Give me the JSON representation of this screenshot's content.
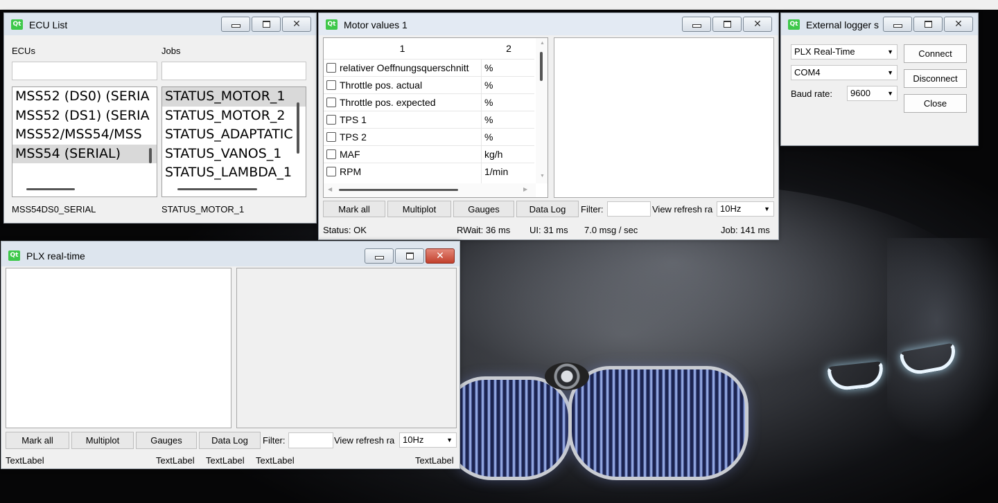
{
  "ecu_window": {
    "title": "ECU List",
    "ecus_label": "ECUs",
    "jobs_label": "Jobs",
    "ecus": [
      "MSS52 (DS0) (SERIA",
      "MSS52 (DS1) (SERIA",
      "MSS52/MSS54/MSS",
      "MSS54 (SERIAL)"
    ],
    "jobs": [
      "STATUS_MOTOR_1",
      "STATUS_MOTOR_2",
      "STATUS_ADAPTATIC",
      "STATUS_VANOS_1",
      "STATUS_LAMBDA_1"
    ],
    "selected_ecu": "MSS54DS0_SERIAL",
    "selected_job": "STATUS_MOTOR_1"
  },
  "motor_window": {
    "title": "Motor values 1",
    "columns": [
      "1",
      "2"
    ],
    "rows": [
      {
        "name": "relativer Oeffnungsquerschnitt",
        "unit": "%"
      },
      {
        "name": "Throttle pos. actual",
        "unit": "%"
      },
      {
        "name": "Throttle pos. expected",
        "unit": "%"
      },
      {
        "name": "TPS 1",
        "unit": "%"
      },
      {
        "name": "TPS 2",
        "unit": "%"
      },
      {
        "name": "MAF",
        "unit": "kg/h"
      },
      {
        "name": "RPM",
        "unit": "1/min"
      }
    ],
    "buttons": {
      "mark_all": "Mark all",
      "multiplot": "Multiplot",
      "gauges": "Gauges",
      "data_log": "Data Log"
    },
    "filter_label": "Filter:",
    "filter_value": "",
    "refresh_label": "View refresh ra",
    "refresh_value": "10Hz",
    "status": {
      "status": "Status: OK",
      "rwait": "RWait:  36 ms",
      "ui": "UI:  31 ms",
      "rate": "7.0 msg / sec",
      "job": "Job:  141 ms"
    }
  },
  "logger_window": {
    "title": "External logger s",
    "logger_type": "PLX Real-Time",
    "port": "COM4",
    "baud_label": "Baud rate:",
    "baud_value": "9600",
    "connect": "Connect",
    "disconnect": "Disconnect",
    "close": "Close"
  },
  "plx_window": {
    "title": "PLX real-time",
    "buttons": {
      "mark_all": "Mark all",
      "multiplot": "Multiplot",
      "gauges": "Gauges",
      "data_log": "Data Log"
    },
    "filter_label": "Filter:",
    "filter_value": "",
    "refresh_label": "View refresh ra",
    "refresh_value": "10Hz",
    "status_labels": [
      "TextLabel",
      "TextLabel",
      "TextLabel",
      "TextLabel",
      "TextLabel"
    ]
  },
  "icons": {
    "qt": "qt-logo-icon",
    "minimize": "minimize-icon",
    "maximize": "maximize-icon",
    "close": "close-icon",
    "dropdown": "chevron-down-icon"
  }
}
